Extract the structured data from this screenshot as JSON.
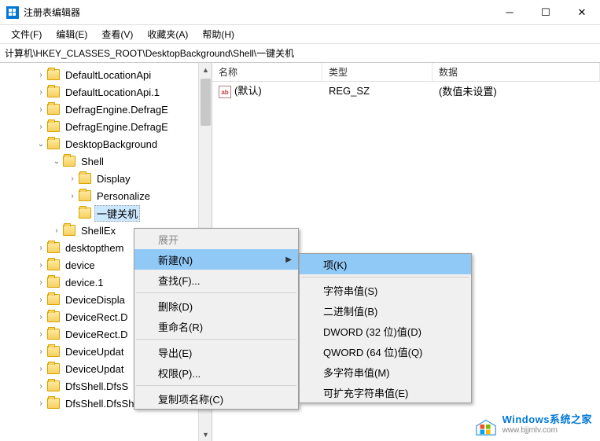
{
  "window": {
    "title": "注册表编辑器"
  },
  "menubar": [
    "文件(F)",
    "编辑(E)",
    "查看(V)",
    "收藏夹(A)",
    "帮助(H)"
  ],
  "address": "计算机\\HKEY_CLASSES_ROOT\\DesktopBackground\\Shell\\一键关机",
  "tree": [
    {
      "indent": 46,
      "toggle": ">",
      "label": "DefaultLocationApi"
    },
    {
      "indent": 46,
      "toggle": ">",
      "label": "DefaultLocationApi.1"
    },
    {
      "indent": 46,
      "toggle": ">",
      "label": "DefragEngine.DefragE"
    },
    {
      "indent": 46,
      "toggle": ">",
      "label": "DefragEngine.DefragE"
    },
    {
      "indent": 46,
      "toggle": "v",
      "label": "DesktopBackground"
    },
    {
      "indent": 66,
      "toggle": "v",
      "label": "Shell"
    },
    {
      "indent": 86,
      "toggle": ">",
      "label": "Display"
    },
    {
      "indent": 86,
      "toggle": ">",
      "label": "Personalize"
    },
    {
      "indent": 86,
      "toggle": "",
      "label": "一键关机",
      "selected": true
    },
    {
      "indent": 66,
      "toggle": ">",
      "label": "ShellEx"
    },
    {
      "indent": 46,
      "toggle": ">",
      "label": "desktopthem"
    },
    {
      "indent": 46,
      "toggle": ">",
      "label": "device"
    },
    {
      "indent": 46,
      "toggle": ">",
      "label": "device.1"
    },
    {
      "indent": 46,
      "toggle": ">",
      "label": "DeviceDispla"
    },
    {
      "indent": 46,
      "toggle": ">",
      "label": "DeviceRect.D"
    },
    {
      "indent": 46,
      "toggle": ">",
      "label": "DeviceRect.D"
    },
    {
      "indent": 46,
      "toggle": ">",
      "label": "DeviceUpdat"
    },
    {
      "indent": 46,
      "toggle": ">",
      "label": "DeviceUpdat"
    },
    {
      "indent": 46,
      "toggle": ">",
      "label": "DfsShell.DfsS"
    },
    {
      "indent": 46,
      "toggle": ">",
      "label": "DfsShell.DfsShell.1"
    }
  ],
  "list": {
    "headers": {
      "name": "名称",
      "type": "类型",
      "data": "数据"
    },
    "rows": [
      {
        "icon": "ab",
        "name": "(默认)",
        "type": "REG_SZ",
        "data": "(数值未设置)"
      }
    ]
  },
  "context_menu_1": [
    {
      "label": "展开",
      "disabled": true
    },
    {
      "label": "新建(N)",
      "highlight": true,
      "submenu": true
    },
    {
      "label": "查找(F)..."
    },
    {
      "sep": true
    },
    {
      "label": "删除(D)"
    },
    {
      "label": "重命名(R)"
    },
    {
      "sep": true
    },
    {
      "label": "导出(E)"
    },
    {
      "label": "权限(P)..."
    },
    {
      "sep": true
    },
    {
      "label": "复制项名称(C)"
    }
  ],
  "context_menu_2": [
    {
      "label": "项(K)",
      "highlight": true
    },
    {
      "sep": true
    },
    {
      "label": "字符串值(S)"
    },
    {
      "label": "二进制值(B)"
    },
    {
      "label": "DWORD (32 位)值(D)"
    },
    {
      "label": "QWORD (64 位)值(Q)"
    },
    {
      "label": "多字符串值(M)"
    },
    {
      "label": "可扩充字符串值(E)"
    }
  ],
  "watermark": {
    "main": "Windows系统之家",
    "sub": "www.bjjmlv.com"
  }
}
